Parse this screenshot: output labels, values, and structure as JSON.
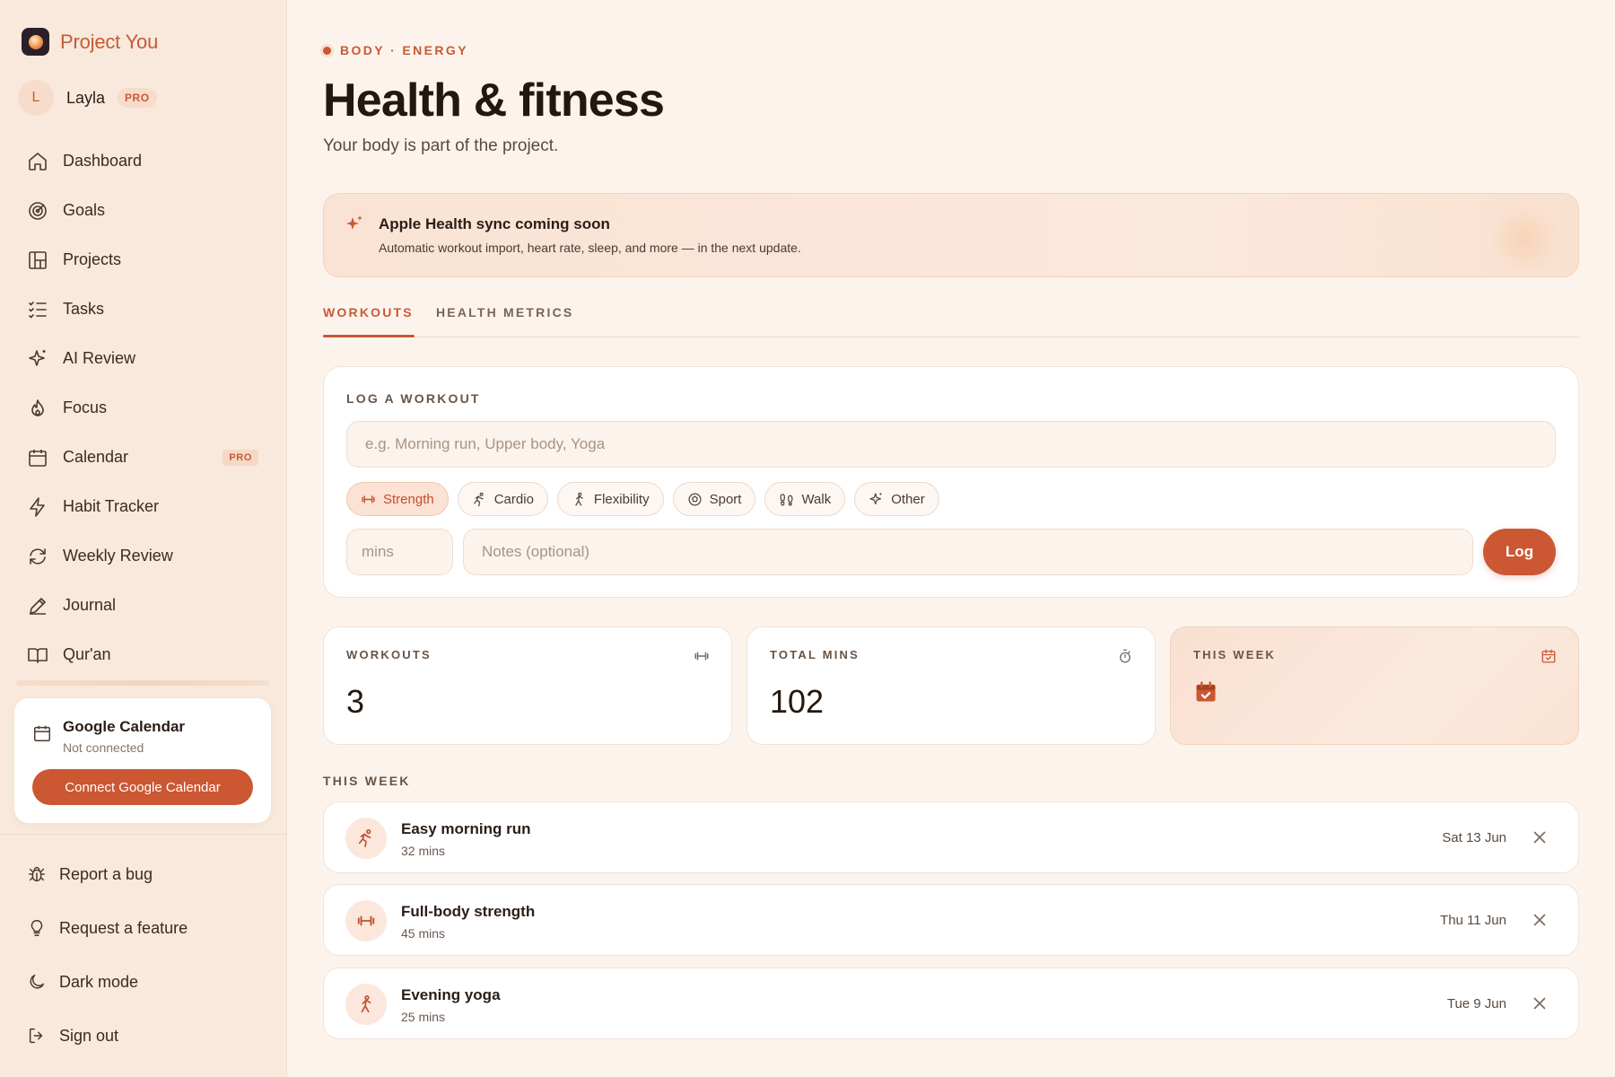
{
  "app": {
    "name": "Project You"
  },
  "user": {
    "initial": "L",
    "name": "Layla",
    "badge": "PRO"
  },
  "nav": {
    "items": [
      {
        "label": "Dashboard",
        "icon": "home-icon"
      },
      {
        "label": "Goals",
        "icon": "target-icon"
      },
      {
        "label": "Projects",
        "icon": "grid-icon"
      },
      {
        "label": "Tasks",
        "icon": "list-check-icon"
      },
      {
        "label": "AI Review",
        "icon": "sparkle-icon"
      },
      {
        "label": "Focus",
        "icon": "flame-icon"
      },
      {
        "label": "Calendar",
        "icon": "calendar-icon",
        "badge": "PRO"
      },
      {
        "label": "Habit Tracker",
        "icon": "bolt-icon"
      },
      {
        "label": "Weekly Review",
        "icon": "refresh-icon"
      },
      {
        "label": "Journal",
        "icon": "pen-icon"
      },
      {
        "label": "Qur'an",
        "icon": "book-icon"
      }
    ]
  },
  "google_calendar": {
    "title": "Google Calendar",
    "status": "Not connected",
    "button": "Connect Google Calendar"
  },
  "bottom_nav": {
    "items": [
      {
        "label": "Report a bug",
        "icon": "bug-icon"
      },
      {
        "label": "Request a feature",
        "icon": "lightbulb-icon"
      },
      {
        "label": "Dark mode",
        "icon": "moon-icon"
      },
      {
        "label": "Sign out",
        "icon": "sign-out-icon"
      }
    ]
  },
  "header": {
    "eyebrow": "BODY · ENERGY",
    "title": "Health & fitness",
    "subtitle": "Your body is part of the project."
  },
  "banner": {
    "title": "Apple Health sync coming soon",
    "text": "Automatic workout import, heart rate, sleep, and more — in the next update."
  },
  "tabs": [
    {
      "label": "WORKOUTS",
      "active": true
    },
    {
      "label": "HEALTH METRICS",
      "active": false
    }
  ],
  "log": {
    "label": "LOG A WORKOUT",
    "name_placeholder": "e.g. Morning run, Upper body, Yoga",
    "types": [
      {
        "label": "Strength",
        "icon": "dumbbell-icon",
        "selected": true
      },
      {
        "label": "Cardio",
        "icon": "runner-icon",
        "selected": false
      },
      {
        "label": "Flexibility",
        "icon": "stretch-icon",
        "selected": false
      },
      {
        "label": "Sport",
        "icon": "ball-icon",
        "selected": false
      },
      {
        "label": "Walk",
        "icon": "footprints-icon",
        "selected": false
      },
      {
        "label": "Other",
        "icon": "sparkle-icon",
        "selected": false
      }
    ],
    "mins_placeholder": "mins",
    "notes_placeholder": "Notes (optional)",
    "submit": "Log"
  },
  "stats": [
    {
      "label": "WORKOUTS",
      "value": "3",
      "icon": "dumbbell-icon"
    },
    {
      "label": "TOTAL MINS",
      "value": "102",
      "icon": "stopwatch-icon"
    },
    {
      "label": "THIS WEEK",
      "value": "",
      "icon": "calendar-check-icon"
    }
  ],
  "week": {
    "label": "THIS WEEK",
    "workouts": [
      {
        "name": "Easy morning run",
        "mins": "32 mins",
        "date": "Sat 13 Jun",
        "icon": "runner-icon"
      },
      {
        "name": "Full-body strength",
        "mins": "45 mins",
        "date": "Thu 11 Jun",
        "icon": "dumbbell-icon"
      },
      {
        "name": "Evening yoga",
        "mins": "25 mins",
        "date": "Tue 9 Jun",
        "icon": "stretch-icon"
      }
    ]
  },
  "colors": {
    "accent": "#cb5733",
    "sidebar_bg": "#f8e9dc",
    "page_bg": "#fcf4ec",
    "card_bg": "#ffffff"
  }
}
